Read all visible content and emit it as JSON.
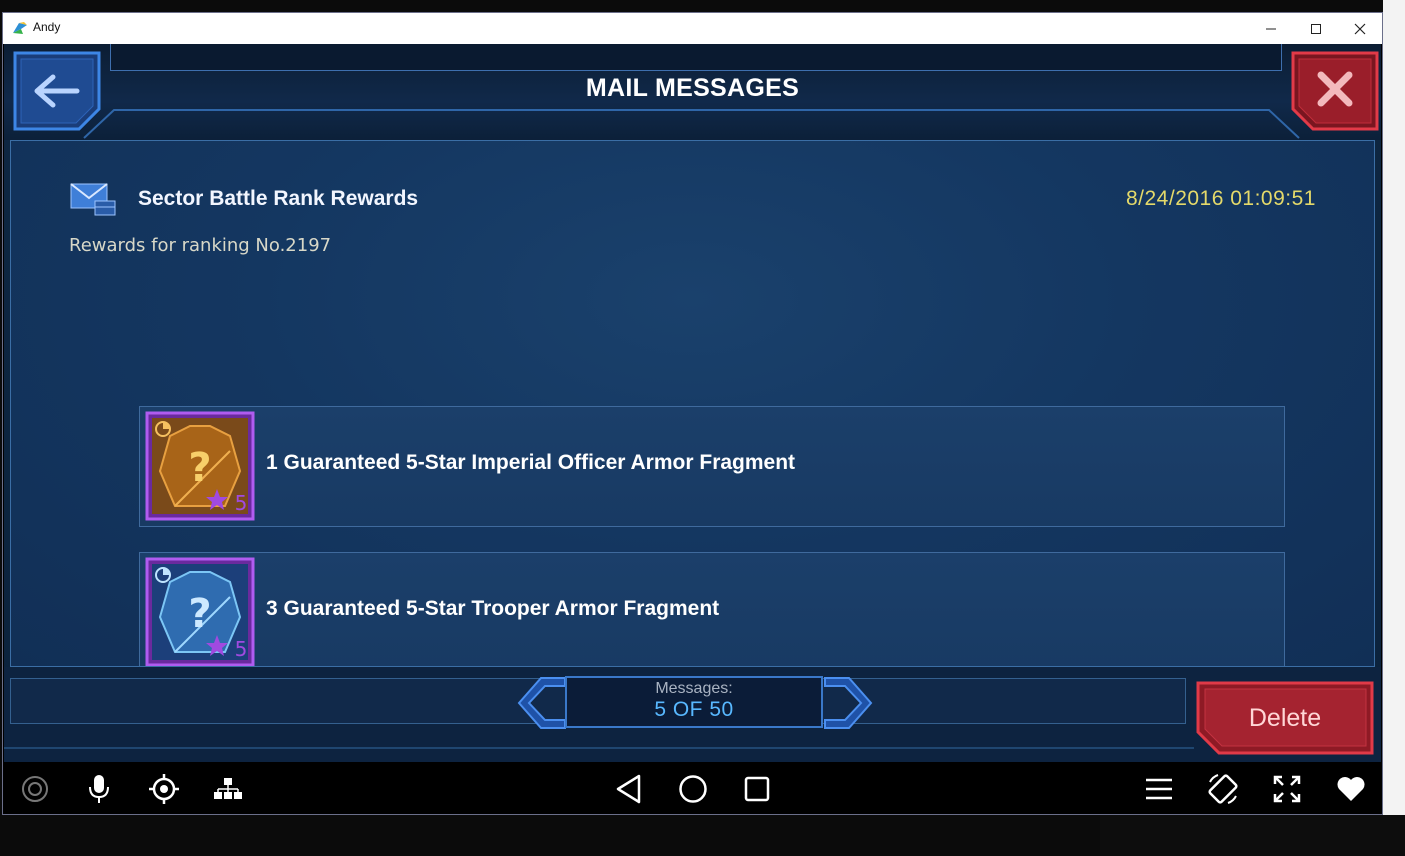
{
  "window": {
    "title": "Andy",
    "minimize_icon": "minimize-icon",
    "maximize_icon": "maximize-icon",
    "close_icon": "close-icon"
  },
  "header": {
    "title": "MAIL MESSAGES",
    "back_icon": "arrow-left-icon",
    "close_icon": "x-icon"
  },
  "message": {
    "subject": "Sector Battle Rank Rewards",
    "date": "8/24/2016 01:09:51",
    "body": "Rewards for ranking No.2197",
    "rewards": [
      {
        "label": "1 Guaranteed 5-Star Imperial Officer Armor Fragment",
        "icon": "imperial-officer-armor-fragment-icon",
        "stars": "5",
        "color": "#d4882a"
      },
      {
        "label": "3 Guaranteed 5-Star Trooper Armor Fragment",
        "icon": "trooper-armor-fragment-icon",
        "stars": "5",
        "color": "#4fa6d8"
      }
    ]
  },
  "pager": {
    "label": "Messages:",
    "value": "5 OF 50"
  },
  "actions": {
    "delete_label": "Delete"
  },
  "navbar": {
    "left_icons": [
      "camera-icon",
      "microphone-icon",
      "location-target-icon",
      "network-icon"
    ],
    "center_icons": [
      "back-triangle-icon",
      "home-circle-icon",
      "recents-square-icon"
    ],
    "right_icons": [
      "menu-icon",
      "rotate-icon",
      "fullscreen-icon",
      "heart-icon"
    ]
  },
  "colors": {
    "accent_blue": "#3a78c9",
    "delete_red": "#b8232f",
    "date_yellow": "#e4d96a"
  }
}
